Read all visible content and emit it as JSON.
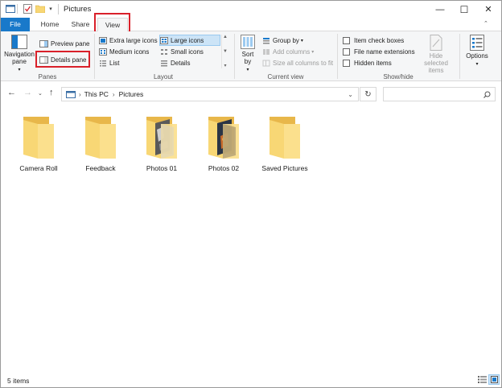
{
  "window": {
    "title": "Pictures"
  },
  "window_controls": {
    "minimize": "—",
    "maximize": "☐",
    "close": "✕"
  },
  "tabs": [
    {
      "label": "File"
    },
    {
      "label": "Home"
    },
    {
      "label": "Share"
    },
    {
      "label": "View",
      "active": true
    }
  ],
  "ribbon": {
    "panes": {
      "group_label": "Panes",
      "navigation_pane": "Navigation pane",
      "preview_pane": "Preview pane",
      "details_pane": "Details pane"
    },
    "layout": {
      "group_label": "Layout",
      "extra_large_icons": "Extra large icons",
      "large_icons": "Large icons",
      "medium_icons": "Medium icons",
      "small_icons": "Small icons",
      "list": "List",
      "details": "Details",
      "selected": "Large icons"
    },
    "current_view": {
      "group_label": "Current view",
      "sort_by": "Sort by",
      "group_by": "Group by",
      "add_columns": "Add columns",
      "size_all_columns": "Size all columns to fit"
    },
    "show_hide": {
      "group_label": "Show/hide",
      "item_check_boxes": "Item check boxes",
      "file_name_extensions": "File name extensions",
      "hidden_items": "Hidden items",
      "hide_selected_items": "Hide selected items"
    },
    "options": {
      "label": "Options"
    }
  },
  "address": {
    "path": [
      "This PC",
      "Pictures"
    ],
    "search_placeholder": ""
  },
  "folders": [
    {
      "name": "Camera Roll",
      "thumbnail": "none"
    },
    {
      "name": "Feedback",
      "thumbnail": "none"
    },
    {
      "name": "Photos 01",
      "thumbnail": "photo"
    },
    {
      "name": "Photos 02",
      "thumbnail": "photo"
    },
    {
      "name": "Saved Pictures",
      "thumbnail": "none"
    }
  ],
  "status": {
    "item_count": "5 items"
  },
  "colors": {
    "accent": "#1979ca",
    "highlight_box": "#d9202a",
    "folder": "#f8d775",
    "selected_layout": "#cce4f7"
  }
}
